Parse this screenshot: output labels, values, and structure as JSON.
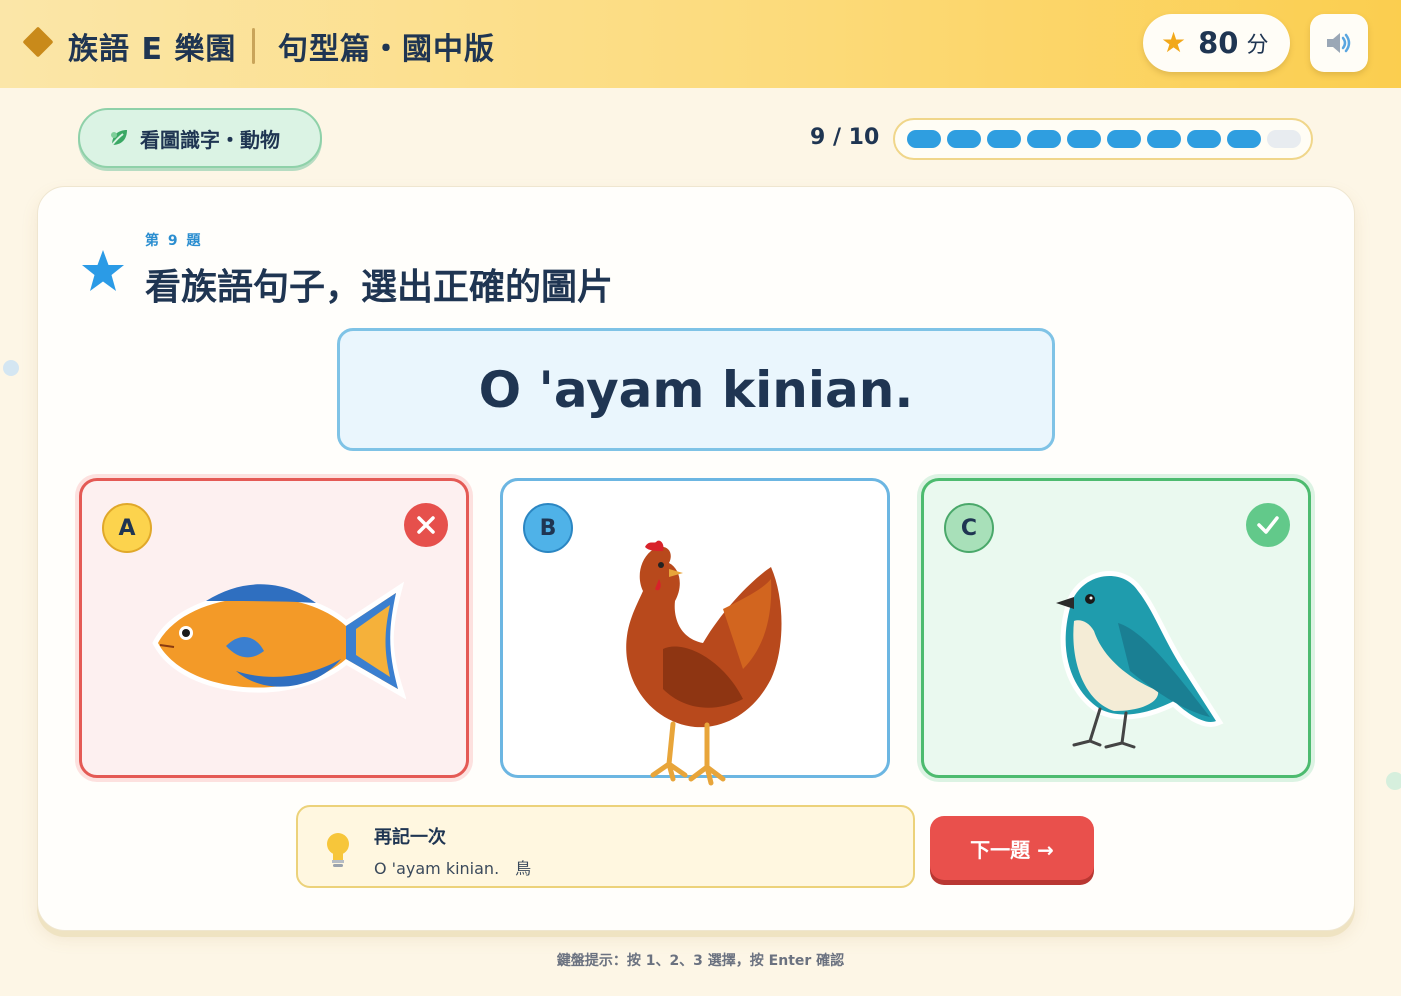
{
  "header": {
    "app_title": "族語 E 樂園",
    "subtitle": "句型篇・國中版",
    "score_value": "80",
    "score_unit": "分",
    "score_icon": "star-icon",
    "sound_icon": "speaker-icon"
  },
  "category": {
    "label": "看圖識字・動物",
    "icon": "leaf-icon"
  },
  "progress": {
    "text": "9 / 10",
    "current": 9,
    "total": 10
  },
  "question": {
    "number_label": "第 9 題",
    "title": "看族語句子，選出正確的圖片",
    "sentence": "O 'ayam kinian."
  },
  "options": [
    {
      "letter": "A",
      "image": "fish",
      "status": "wrong"
    },
    {
      "letter": "B",
      "image": "chicken",
      "status": "none"
    },
    {
      "letter": "C",
      "image": "bird",
      "status": "correct"
    }
  ],
  "hint": {
    "title": "再記一次",
    "text": "O 'ayam kinian.　鳥",
    "icon": "lightbulb-icon"
  },
  "next_button": {
    "label": "下一題 →"
  },
  "keyboard_hint": "鍵盤提示：按 1、2、3 選擇，按 Enter 確認",
  "colors": {
    "accent_blue": "#2f9ee0",
    "wrong_red": "#e45a55",
    "correct_green": "#4dbb6f",
    "header_yellow": "#fcdb7c"
  }
}
